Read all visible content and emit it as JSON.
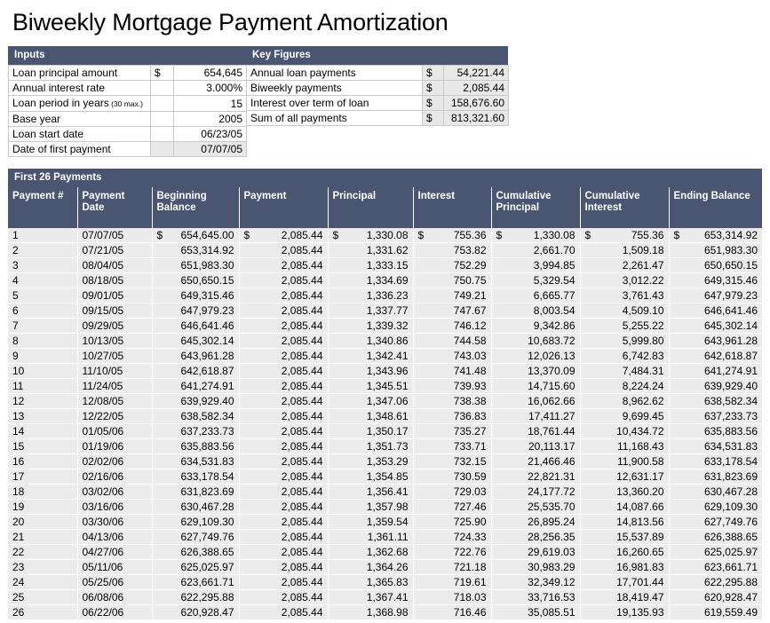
{
  "title": "Biweekly Mortgage Payment Amortization",
  "inputs": {
    "header": "Inputs",
    "rows": [
      {
        "label": "Loan principal amount",
        "sub": "",
        "currency": "$",
        "value": "654,645",
        "shaded": false
      },
      {
        "label": "Annual interest rate",
        "sub": "",
        "currency": "",
        "value": "3.000%",
        "shaded": false
      },
      {
        "label": "Loan period in years",
        "sub": "(30 max.)",
        "currency": "",
        "value": "15",
        "shaded": false
      },
      {
        "label": "Base year",
        "sub": "",
        "currency": "",
        "value": "2005",
        "shaded": false
      },
      {
        "label": "Loan start date",
        "sub": "",
        "currency": "",
        "value": "06/23/05",
        "shaded": false
      },
      {
        "label": "Date of first payment",
        "sub": "",
        "currency": "",
        "value": "07/07/05",
        "shaded": true
      }
    ]
  },
  "key_figures": {
    "header": "Key Figures",
    "rows": [
      {
        "label": "Annual loan payments",
        "currency": "$",
        "value": "54,221.44"
      },
      {
        "label": "Biweekly payments",
        "currency": "$",
        "value": "2,085.44"
      },
      {
        "label": "Interest over term of loan",
        "currency": "$",
        "value": "158,676.60"
      },
      {
        "label": "Sum of all payments",
        "currency": "$",
        "value": "813,321.60"
      }
    ]
  },
  "payments": {
    "header": "First 26 Payments",
    "columns": [
      "Payment #",
      "Payment Date",
      "Beginning Balance",
      "Payment",
      "Principal",
      "Interest",
      "Cumulative Principal",
      "Cumulative Interest",
      "Ending Balance"
    ],
    "rows": [
      {
        "n": "1",
        "date": "07/07/05",
        "beginning": "654,645.00",
        "payment": "2,085.44",
        "principal": "1,330.08",
        "interest": "755.36",
        "cum_principal": "1,330.08",
        "cum_interest": "755.36",
        "ending": "653,314.92",
        "cur": true
      },
      {
        "n": "2",
        "date": "07/21/05",
        "beginning": "653,314.92",
        "payment": "2,085.44",
        "principal": "1,331.62",
        "interest": "753.82",
        "cum_principal": "2,661.70",
        "cum_interest": "1,509.18",
        "ending": "651,983.30",
        "cur": false
      },
      {
        "n": "3",
        "date": "08/04/05",
        "beginning": "651,983.30",
        "payment": "2,085.44",
        "principal": "1,333.15",
        "interest": "752.29",
        "cum_principal": "3,994.85",
        "cum_interest": "2,261.47",
        "ending": "650,650.15",
        "cur": false
      },
      {
        "n": "4",
        "date": "08/18/05",
        "beginning": "650,650.15",
        "payment": "2,085.44",
        "principal": "1,334.69",
        "interest": "750.75",
        "cum_principal": "5,329.54",
        "cum_interest": "3,012.22",
        "ending": "649,315.46",
        "cur": false
      },
      {
        "n": "5",
        "date": "09/01/05",
        "beginning": "649,315.46",
        "payment": "2,085.44",
        "principal": "1,336.23",
        "interest": "749.21",
        "cum_principal": "6,665.77",
        "cum_interest": "3,761.43",
        "ending": "647,979.23",
        "cur": false
      },
      {
        "n": "6",
        "date": "09/15/05",
        "beginning": "647,979.23",
        "payment": "2,085.44",
        "principal": "1,337.77",
        "interest": "747.67",
        "cum_principal": "8,003.54",
        "cum_interest": "4,509.10",
        "ending": "646,641.46",
        "cur": false
      },
      {
        "n": "7",
        "date": "09/29/05",
        "beginning": "646,641.46",
        "payment": "2,085.44",
        "principal": "1,339.32",
        "interest": "746.12",
        "cum_principal": "9,342.86",
        "cum_interest": "5,255.22",
        "ending": "645,302.14",
        "cur": false
      },
      {
        "n": "8",
        "date": "10/13/05",
        "beginning": "645,302.14",
        "payment": "2,085.44",
        "principal": "1,340.86",
        "interest": "744.58",
        "cum_principal": "10,683.72",
        "cum_interest": "5,999.80",
        "ending": "643,961.28",
        "cur": false
      },
      {
        "n": "9",
        "date": "10/27/05",
        "beginning": "643,961.28",
        "payment": "2,085.44",
        "principal": "1,342.41",
        "interest": "743.03",
        "cum_principal": "12,026.13",
        "cum_interest": "6,742.83",
        "ending": "642,618.87",
        "cur": false
      },
      {
        "n": "10",
        "date": "11/10/05",
        "beginning": "642,618.87",
        "payment": "2,085.44",
        "principal": "1,343.96",
        "interest": "741.48",
        "cum_principal": "13,370.09",
        "cum_interest": "7,484.31",
        "ending": "641,274.91",
        "cur": false
      },
      {
        "n": "11",
        "date": "11/24/05",
        "beginning": "641,274.91",
        "payment": "2,085.44",
        "principal": "1,345.51",
        "interest": "739.93",
        "cum_principal": "14,715.60",
        "cum_interest": "8,224.24",
        "ending": "639,929.40",
        "cur": false
      },
      {
        "n": "12",
        "date": "12/08/05",
        "beginning": "639,929.40",
        "payment": "2,085.44",
        "principal": "1,347.06",
        "interest": "738.38",
        "cum_principal": "16,062.66",
        "cum_interest": "8,962.62",
        "ending": "638,582.34",
        "cur": false
      },
      {
        "n": "13",
        "date": "12/22/05",
        "beginning": "638,582.34",
        "payment": "2,085.44",
        "principal": "1,348.61",
        "interest": "736.83",
        "cum_principal": "17,411.27",
        "cum_interest": "9,699.45",
        "ending": "637,233.73",
        "cur": false
      },
      {
        "n": "14",
        "date": "01/05/06",
        "beginning": "637,233.73",
        "payment": "2,085.44",
        "principal": "1,350.17",
        "interest": "735.27",
        "cum_principal": "18,761.44",
        "cum_interest": "10,434.72",
        "ending": "635,883.56",
        "cur": false
      },
      {
        "n": "15",
        "date": "01/19/06",
        "beginning": "635,883.56",
        "payment": "2,085.44",
        "principal": "1,351.73",
        "interest": "733.71",
        "cum_principal": "20,113.17",
        "cum_interest": "11,168.43",
        "ending": "634,531.83",
        "cur": false
      },
      {
        "n": "16",
        "date": "02/02/06",
        "beginning": "634,531.83",
        "payment": "2,085.44",
        "principal": "1,353.29",
        "interest": "732.15",
        "cum_principal": "21,466.46",
        "cum_interest": "11,900.58",
        "ending": "633,178.54",
        "cur": false
      },
      {
        "n": "17",
        "date": "02/16/06",
        "beginning": "633,178.54",
        "payment": "2,085.44",
        "principal": "1,354.85",
        "interest": "730.59",
        "cum_principal": "22,821.31",
        "cum_interest": "12,631.17",
        "ending": "631,823.69",
        "cur": false
      },
      {
        "n": "18",
        "date": "03/02/06",
        "beginning": "631,823.69",
        "payment": "2,085.44",
        "principal": "1,356.41",
        "interest": "729.03",
        "cum_principal": "24,177.72",
        "cum_interest": "13,360.20",
        "ending": "630,467.28",
        "cur": false
      },
      {
        "n": "19",
        "date": "03/16/06",
        "beginning": "630,467.28",
        "payment": "2,085.44",
        "principal": "1,357.98",
        "interest": "727.46",
        "cum_principal": "25,535.70",
        "cum_interest": "14,087.66",
        "ending": "629,109.30",
        "cur": false
      },
      {
        "n": "20",
        "date": "03/30/06",
        "beginning": "629,109.30",
        "payment": "2,085.44",
        "principal": "1,359.54",
        "interest": "725.90",
        "cum_principal": "26,895.24",
        "cum_interest": "14,813.56",
        "ending": "627,749.76",
        "cur": false
      },
      {
        "n": "21",
        "date": "04/13/06",
        "beginning": "627,749.76",
        "payment": "2,085.44",
        "principal": "1,361.11",
        "interest": "724.33",
        "cum_principal": "28,256.35",
        "cum_interest": "15,537.89",
        "ending": "626,388.65",
        "cur": false
      },
      {
        "n": "22",
        "date": "04/27/06",
        "beginning": "626,388.65",
        "payment": "2,085.44",
        "principal": "1,362.68",
        "interest": "722.76",
        "cum_principal": "29,619.03",
        "cum_interest": "16,260.65",
        "ending": "625,025.97",
        "cur": false
      },
      {
        "n": "23",
        "date": "05/11/06",
        "beginning": "625,025.97",
        "payment": "2,085.44",
        "principal": "1,364.26",
        "interest": "721.18",
        "cum_principal": "30,983.29",
        "cum_interest": "16,981.83",
        "ending": "623,661.71",
        "cur": false
      },
      {
        "n": "24",
        "date": "05/25/06",
        "beginning": "623,661.71",
        "payment": "2,085.44",
        "principal": "1,365.83",
        "interest": "719.61",
        "cum_principal": "32,349.12",
        "cum_interest": "17,701.44",
        "ending": "622,295.88",
        "cur": false
      },
      {
        "n": "25",
        "date": "06/08/06",
        "beginning": "622,295.88",
        "payment": "2,085.44",
        "principal": "1,367.41",
        "interest": "718.03",
        "cum_principal": "33,716.53",
        "cum_interest": "18,419.47",
        "ending": "620,928.47",
        "cur": false
      },
      {
        "n": "26",
        "date": "06/22/06",
        "beginning": "620,928.47",
        "payment": "2,085.44",
        "principal": "1,368.98",
        "interest": "716.46",
        "cum_principal": "35,085.51",
        "cum_interest": "19,135.93",
        "ending": "619,559.49",
        "cur": false
      }
    ],
    "currency_symbol": "$"
  },
  "colors": {
    "header_blue": "#4a5572",
    "row_gray": "#ebebeb",
    "shaded_cell": "#e8e8e8"
  }
}
